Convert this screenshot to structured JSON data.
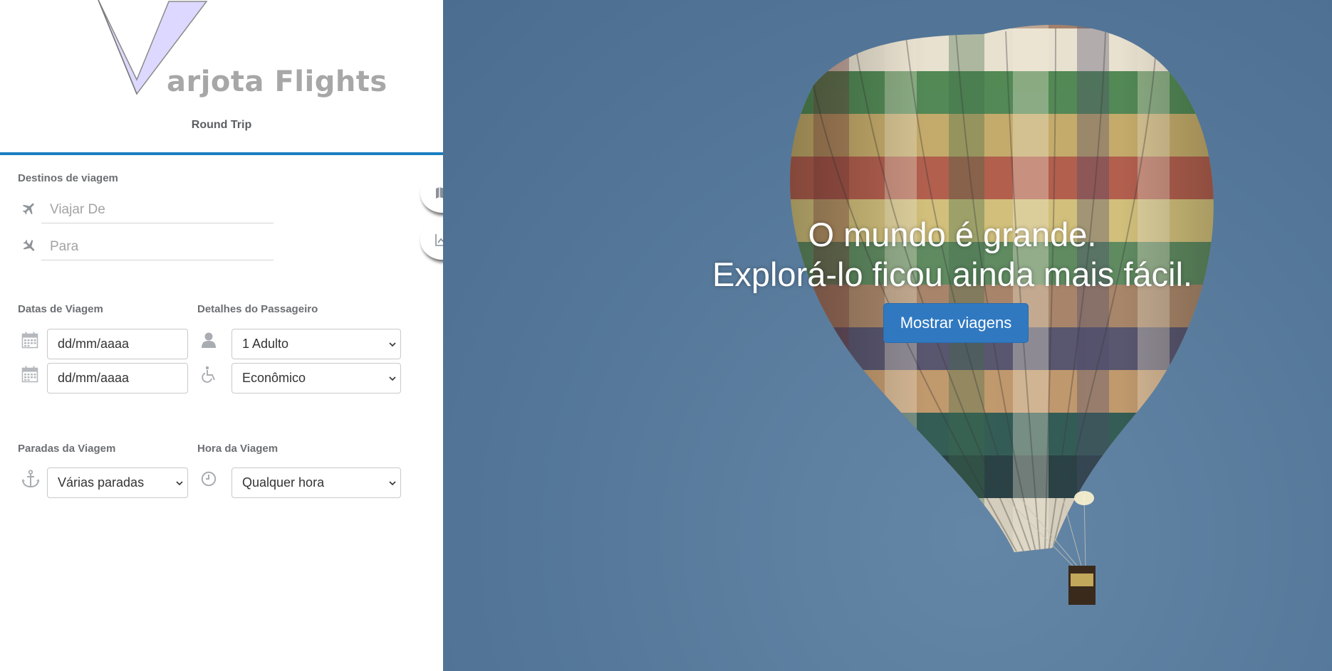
{
  "brand": {
    "name": "arjota Flights"
  },
  "trip_type": "Round Trip",
  "sections": {
    "destinations": "Destinos de viagem",
    "dates": "Datas de Viagem",
    "passenger": "Detalhes do Passageiro",
    "stops": "Paradas da Viagem",
    "time": "Hora da Viagem"
  },
  "fields": {
    "from_placeholder": "Viajar De",
    "to_placeholder": "Para",
    "depart_date": "dd/mm/aaaa",
    "return_date": "dd/mm/aaaa",
    "passengers": "1 Adulto",
    "cabin_class": "Econômico",
    "stops": "Várias paradas",
    "time": "Qualquer hora"
  },
  "icons": {
    "from": "plane-icon",
    "to": "plane-landing-icon",
    "date": "calendar-icon",
    "passenger": "user-icon",
    "cabin": "wheelchair-icon",
    "stops": "anchor-icon",
    "time": "clock-icon",
    "map_button": "map-icon",
    "chart_button": "line-chart-icon"
  },
  "hero": {
    "line1": "O mundo é grande.",
    "line2": "Explorá-lo ficou ainda mais fácil.",
    "button": "Mostrar viagens"
  },
  "colors": {
    "accent_rule": "#1a7fc2",
    "button_primary": "#3079c1",
    "sky": "#55789a",
    "label_gray": "#6c6f73"
  }
}
